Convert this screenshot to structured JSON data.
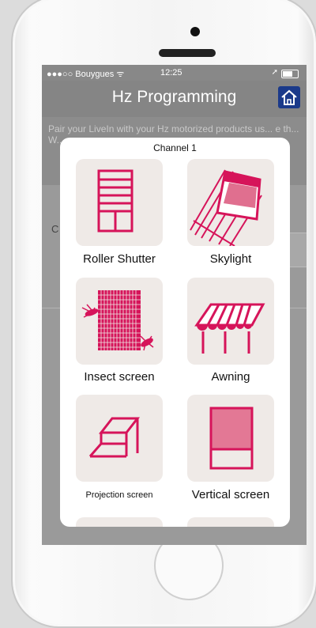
{
  "status_bar": {
    "carrier": "●●●○○ Bouygues ᯤ",
    "time": "12:25",
    "location_icon": "location-arrow-icon",
    "battery_icon": "battery-icon"
  },
  "nav": {
    "title": "Hz Programming",
    "home_icon": "home-icon"
  },
  "background_text": {
    "intro": "Pair your LiveIn with your Hz motorized products us... e th... W...",
    "c_label": "C"
  },
  "modal": {
    "title": "Channel 1",
    "items": [
      {
        "label": "Roller Shutter",
        "icon": "roller-shutter-icon"
      },
      {
        "label": "Skylight",
        "icon": "skylight-icon"
      },
      {
        "label": "Insect screen",
        "icon": "insect-screen-icon"
      },
      {
        "label": "Awning",
        "icon": "awning-icon"
      },
      {
        "label": "Projection screen",
        "icon": "projection-screen-icon"
      },
      {
        "label": "Vertical screen",
        "icon": "vertical-screen-icon"
      }
    ]
  },
  "colors": {
    "accent": "#d6145a",
    "tile_bg": "#efeae7",
    "nav_bg": "#858585",
    "home_icon_bg": "#1b3a8a"
  }
}
